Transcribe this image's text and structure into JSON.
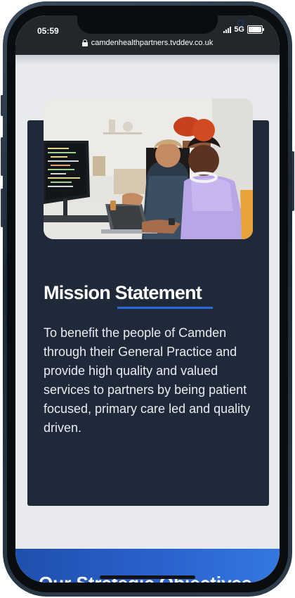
{
  "status_bar": {
    "time": "05:59",
    "network": "5G",
    "signal_icon": "signal-bars-icon",
    "battery_icon": "battery-icon"
  },
  "browser": {
    "url": "camdenhealthpartners.tvddev.co.uk",
    "lock_icon": "lock-icon"
  },
  "mission": {
    "image_alt": "",
    "title": "Mission Statement",
    "text": "To benefit the people of Camden through their General Practice and provide high quality and valued services to partners by being patient focused, primary care led and quality driven."
  },
  "objectives": {
    "title": "Our Strategic Objectives"
  },
  "colors": {
    "card_bg": "#1f2939",
    "accent": "#2a6ad8",
    "page_bg": "#e9eaee",
    "objectives_bg": "#2a62cc"
  }
}
